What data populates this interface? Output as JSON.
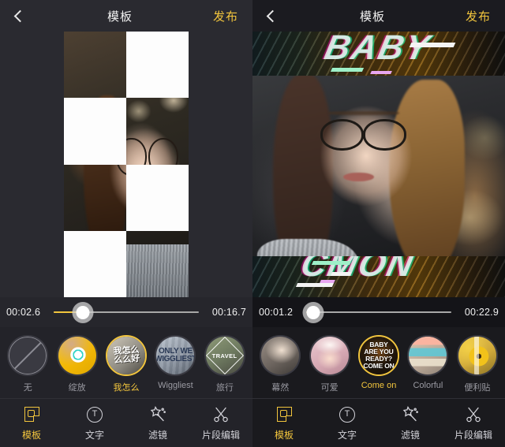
{
  "app": {
    "accent_color": "#f2c53d",
    "text_color": "#f0f0f0",
    "muted_color": "#9a9aa2"
  },
  "panels": [
    {
      "id": "left",
      "header": {
        "back_icon": "chevron-left-icon",
        "title": "模板",
        "publish_label": "发布"
      },
      "preview": {
        "effect": "checkerboard-tile-transition"
      },
      "timeline": {
        "current_time": "00:02.6",
        "total_time": "00:16.7",
        "progress_percent": 20
      },
      "templates": [
        {
          "label": "无",
          "icon": "no-template-icon",
          "thumb": "none",
          "selected": false
        },
        {
          "label": "绽放",
          "icon": "template-thumb",
          "thumb": "bloom",
          "selected": false
        },
        {
          "label": "我怎么",
          "icon": "template-thumb",
          "thumb": "wozenme",
          "thumb_text": "我怎么\n么么好",
          "selected": true
        },
        {
          "label": "Wiggliest",
          "icon": "template-thumb",
          "thumb": "wiggliest",
          "thumb_text": "ONLY WE\nWIGGLIEST",
          "selected": false
        },
        {
          "label": "旅行",
          "icon": "template-thumb",
          "thumb": "travel",
          "thumb_text": "TRAVEL",
          "selected": false
        }
      ],
      "nav": [
        {
          "label": "模板",
          "icon": "template-icon",
          "active": true
        },
        {
          "label": "文字",
          "icon": "text-icon",
          "active": false
        },
        {
          "label": "滤镜",
          "icon": "filter-wand-icon",
          "active": false
        },
        {
          "label": "片段编辑",
          "icon": "scissors-icon",
          "active": false
        }
      ]
    },
    {
      "id": "right",
      "header": {
        "back_icon": "chevron-left-icon",
        "title": "模板",
        "publish_label": "发布"
      },
      "preview": {
        "effect": "glitch-band-transition"
      },
      "timeline": {
        "current_time": "00:01.2",
        "total_time": "00:22.9",
        "progress_percent": 5
      },
      "templates": [
        {
          "label": "幕然",
          "icon": "template-thumb",
          "thumb": "muran",
          "selected": false
        },
        {
          "label": "可爱",
          "icon": "template-thumb",
          "thumb": "keai",
          "selected": false
        },
        {
          "label": "Come on",
          "icon": "template-thumb",
          "thumb": "baby",
          "thumb_text": "BABY\nARE YOU\nREADY?\nCOME ON",
          "selected": true
        },
        {
          "label": "Colorful",
          "icon": "template-thumb",
          "thumb": "colorful",
          "selected": false
        },
        {
          "label": "便利贴",
          "icon": "template-thumb",
          "thumb": "note",
          "selected": false
        }
      ],
      "nav": [
        {
          "label": "模板",
          "icon": "template-icon",
          "active": true
        },
        {
          "label": "文字",
          "icon": "text-icon",
          "active": false
        },
        {
          "label": "滤镜",
          "icon": "filter-wand-icon",
          "active": false
        },
        {
          "label": "片段编辑",
          "icon": "scissors-icon",
          "active": false
        }
      ]
    }
  ]
}
